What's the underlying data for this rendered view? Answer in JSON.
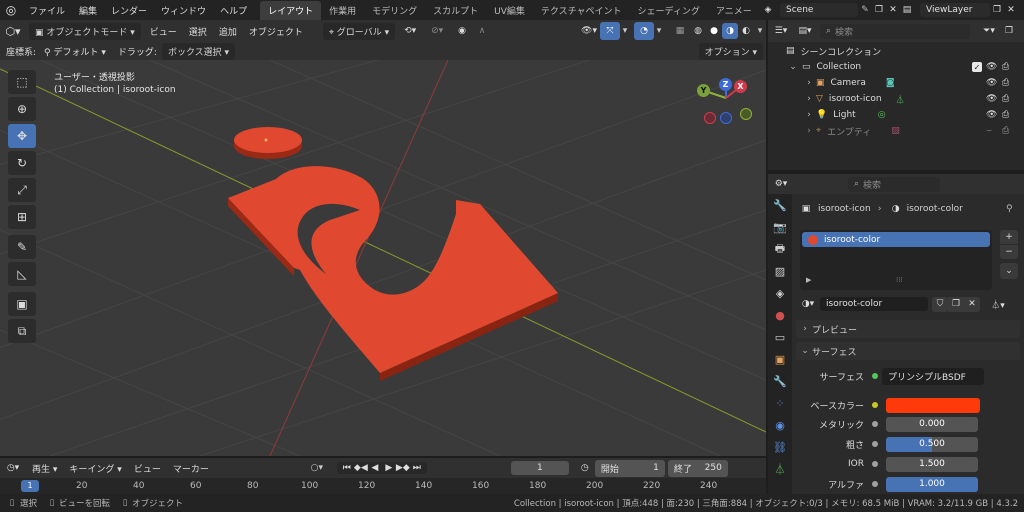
{
  "menu": [
    "ファイル",
    "編集",
    "レンダー",
    "ウィンドウ",
    "ヘルプ"
  ],
  "workspaces": [
    "レイアウト",
    "作業用",
    "モデリング",
    "スカルプト",
    "UV編集",
    "テクスチャペイント",
    "シェーディング",
    "アニメー"
  ],
  "scene": {
    "name": "Scene",
    "view_layer": "ViewLayer"
  },
  "viewport": {
    "mode": "オブジェクトモード",
    "menus": [
      "ビュー",
      "選択",
      "追加",
      "オブジェクト"
    ],
    "orientation": "グローバル",
    "coord_label": "座標系:",
    "coord_value": "デフォルト",
    "drag_label": "ドラッグ:",
    "drag_value": "ボックス選択",
    "options": "オプション",
    "overlay_title": "ユーザー・透視投影",
    "overlay_sub": "(1) Collection | isoroot-icon",
    "gizmo": {
      "x": "X",
      "y": "Y",
      "z": "Z"
    },
    "object_color": "#e0482f"
  },
  "timeline": {
    "playback": "再生",
    "keying": "キーイング",
    "view": "ビュー",
    "marker": "マーカー",
    "current_frame": "1",
    "start_label": "開始",
    "start": "1",
    "end_label": "終了",
    "end": "250",
    "ruler": [
      "1",
      "20",
      "40",
      "60",
      "80",
      "100",
      "120",
      "140",
      "160",
      "180",
      "200",
      "220",
      "240"
    ]
  },
  "outliner": {
    "search_placeholder": "検索",
    "root": "シーンコレクション",
    "collection": "Collection",
    "items": [
      "Camera",
      "isoroot-icon",
      "Light",
      "エンプティ"
    ]
  },
  "properties": {
    "search_placeholder": "検索",
    "breadcrumb_object": "isoroot-icon",
    "breadcrumb_material": "isoroot-color",
    "slot_name": "isoroot-color",
    "material_name": "isoroot-color",
    "preview_panel": "プレビュー",
    "surface_panel": "サーフェス",
    "surface_label": "サーフェス",
    "surface_value": "プリンシプルBSDF",
    "base_color_label": "ベースカラー",
    "base_color": "#ff3a0a",
    "fields": [
      {
        "label": "メタリック",
        "value": "0.000",
        "fraction": 0.0
      },
      {
        "label": "粗さ",
        "value": "0.500",
        "fraction": 0.5
      },
      {
        "label": "IOR",
        "value": "1.500",
        "fraction": 0.0
      },
      {
        "label": "アルファ",
        "value": "1.000",
        "fraction": 1.0
      }
    ]
  },
  "status": {
    "select": "選択",
    "rotate": "ビューを回転",
    "object": "オブジェクト",
    "info": "Collection | isoroot-icon | 頂点:448 | 面:230 | 三角面:884 | オブジェクト:0/3 | メモリ: 68.5 MiB | VRAM: 3.2/11.9 GB | 4.3.2"
  }
}
